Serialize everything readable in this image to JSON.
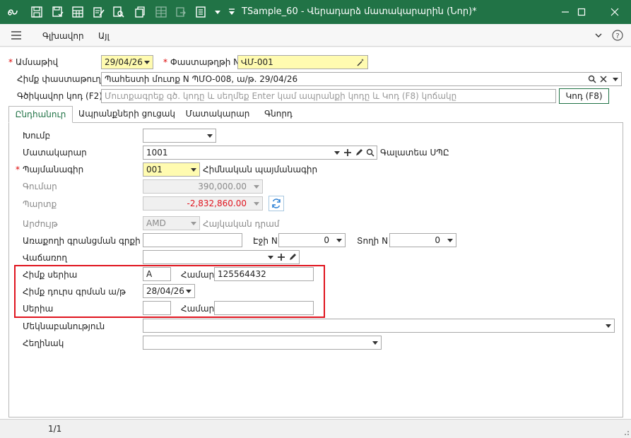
{
  "window": {
    "title": "TSample_60 - Վերադարձ մատակարարին (Նոր)*"
  },
  "menu": {
    "main_label": "Գլխավոր",
    "other_label": "Այլ"
  },
  "header": {
    "date_label": "Ամսաթիվ",
    "date_value": "29/04/26",
    "docnum_label": "Փաստաթղթի N",
    "docnum_value": "ՎՄ-001",
    "basedoc_label": "Հիմք փաստաթուղթ",
    "basedoc_value": "Պահեստի մուտք N ՊՄՕ-008, ա/թ.  29/04/26",
    "barcode_label": "Գծիկավոր կոդ (F2)",
    "barcode_placeholder": "Մուտքագրեք գծ. կոդը և սեղմեք Enter կամ ապրանքի կոդը և Կոդ (F8) կոճակը",
    "code_button": "Կոդ (F8)"
  },
  "tabs": [
    {
      "label": "Ընդհանուր"
    },
    {
      "label": "Ապրանքների ցուցակ"
    },
    {
      "label": "Մատակարար"
    },
    {
      "label": "Գնորդ"
    }
  ],
  "form": {
    "group_label": "Խումբ",
    "group_value": "",
    "supplier_label": "Մատակարար",
    "supplier_value": "1001",
    "supplier_name": "Գալատեա ՍՊԸ",
    "contract_label": "Պայմանագիր",
    "contract_value": "001",
    "contract_name": "Հիմնական պայմանագիր",
    "amount_label": "Գումար",
    "amount_value": "390,000.00",
    "debt_label": "Պարտք",
    "debt_value": "-2,832,860.00",
    "currency_label": "Արժույթ",
    "currency_value": "AMD",
    "currency_name": "Հայկական դրամ",
    "ledger_label": "Առաքողի գրանցման գրքի N",
    "page_label": "Էջի N",
    "page_value": "0",
    "line_label": "Տողի N",
    "line_value": "0",
    "seller_label": "Վաճառող",
    "base_series_label": "Հիմք սերիա",
    "base_series_value": "A",
    "base_number_label": "Համար",
    "base_number_value": "125564432",
    "base_date_label": "Հիմք դուրս գրման ա/թ",
    "base_date_value": "28/04/26",
    "series_label": "Սերիա",
    "series_value": "",
    "number_label": "Համար",
    "number_value": "",
    "comment_label": "Մեկնաբանություն",
    "author_label": "Հեղինակ"
  },
  "status": {
    "page": "1/1"
  },
  "colors": {
    "accent": "#217346",
    "required": "#dd0000",
    "negative": "#e0141e",
    "highlight_box": "#e0141e",
    "required_field_bg": "#fffbb0"
  }
}
